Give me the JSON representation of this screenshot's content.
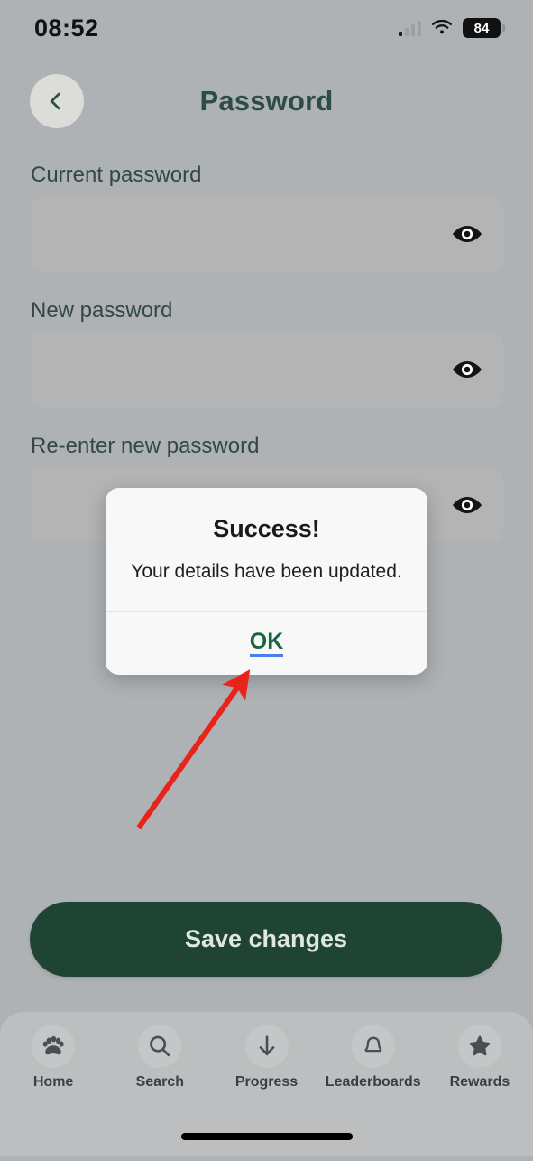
{
  "status_bar": {
    "time": "08:52",
    "battery_level": "84",
    "signal_icon": "cellular-signal-icon",
    "wifi_icon": "wifi-icon",
    "battery_icon": "battery-icon"
  },
  "header": {
    "back_icon": "chevron-left-icon",
    "title": "Password"
  },
  "form": {
    "fields": [
      {
        "label": "Current password",
        "value": "",
        "placeholder": "",
        "toggle_icon": "eye-icon"
      },
      {
        "label": "New password",
        "value": "",
        "placeholder": "",
        "toggle_icon": "eye-icon"
      },
      {
        "label": "Re-enter new password",
        "value": "",
        "placeholder": "",
        "toggle_icon": "eye-icon"
      }
    ],
    "save_label": "Save changes"
  },
  "dialog": {
    "title": "Success!",
    "message": "Your details have been updated.",
    "ok_label": "OK"
  },
  "bottom_nav": {
    "items": [
      {
        "label": "Home",
        "icon": "paw-icon"
      },
      {
        "label": "Search",
        "icon": "search-icon"
      },
      {
        "label": "Progress",
        "icon": "arrow-down-icon"
      },
      {
        "label": "Leaderboards",
        "icon": "bell-icon"
      },
      {
        "label": "Rewards",
        "icon": "star-icon"
      }
    ]
  },
  "annotation": {
    "arrow_color": "#e8231a",
    "points_to": "OK"
  },
  "colors": {
    "background": "#aeb2b5",
    "brand_green": "#1f4434",
    "label_green": "#33493f",
    "field_fill": "#b4b4b4",
    "dialog_bg": "#f8f8f8",
    "ok_green": "#1c6341",
    "nav_bg": "#bcbebf"
  }
}
